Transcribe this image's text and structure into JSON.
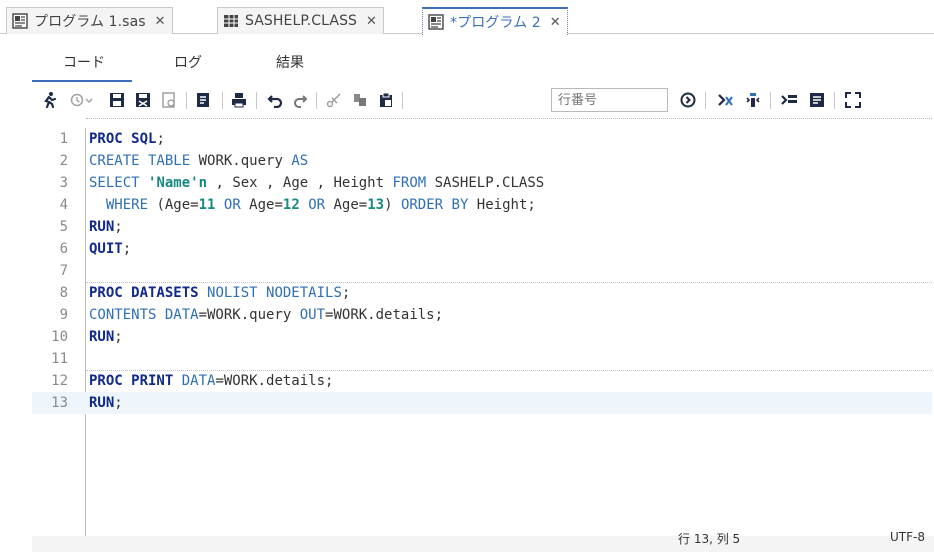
{
  "doc_tabs": [
    {
      "label": "プログラム 1.sas",
      "icon": "sas-program-icon",
      "active": false
    },
    {
      "label": "SASHELP.CLASS",
      "icon": "table-grid-icon",
      "active": false
    },
    {
      "label": "*プログラム 2",
      "icon": "sas-program-icon",
      "active": true
    }
  ],
  "sub_tabs": [
    {
      "label": "コード",
      "active": true
    },
    {
      "label": "ログ",
      "active": false
    },
    {
      "label": "結果",
      "active": false
    }
  ],
  "toolbar": {
    "buttons": [
      "run-icon",
      "history-icon",
      "save-icon",
      "save-as-icon",
      "save-as-template-icon",
      "open-program-icon",
      "print-icon",
      "undo-icon",
      "redo-icon",
      "cut-icon",
      "copy-icon",
      "paste-icon",
      "go-to-line-icon",
      "clear-icon",
      "format-code-icon",
      "add-snippet-icon",
      "editor-options-icon",
      "maximize-icon"
    ],
    "line_number_placeholder": "行番号"
  },
  "code": {
    "lines": [
      {
        "no": "1",
        "tokens": [
          [
            "kw-step",
            "PROC SQL"
          ],
          [
            "plain",
            ";"
          ]
        ]
      },
      {
        "no": "2",
        "tokens": [
          [
            "kw",
            "CREATE TABLE"
          ],
          [
            "plain",
            " WORK.query "
          ],
          [
            "kw",
            "AS"
          ]
        ]
      },
      {
        "no": "3",
        "tokens": [
          [
            "kw",
            "SELECT"
          ],
          [
            "plain",
            " "
          ],
          [
            "str",
            "'Name'n"
          ],
          [
            "plain",
            " , Sex , Age , Height "
          ],
          [
            "kw",
            "FROM"
          ],
          [
            "plain",
            " SASHELP.CLASS"
          ]
        ]
      },
      {
        "no": "4",
        "tokens": [
          [
            "plain",
            "  "
          ],
          [
            "kw",
            "WHERE"
          ],
          [
            "plain",
            " (Age="
          ],
          [
            "num",
            "11"
          ],
          [
            "plain",
            " "
          ],
          [
            "kw",
            "OR"
          ],
          [
            "plain",
            " Age="
          ],
          [
            "num",
            "12"
          ],
          [
            "plain",
            " "
          ],
          [
            "kw",
            "OR"
          ],
          [
            "plain",
            " Age="
          ],
          [
            "num",
            "13"
          ],
          [
            "plain",
            ") "
          ],
          [
            "kw",
            "ORDER BY"
          ],
          [
            "plain",
            " Height;"
          ]
        ]
      },
      {
        "no": "5",
        "tokens": [
          [
            "kw-step",
            "RUN"
          ],
          [
            "plain",
            ";"
          ]
        ]
      },
      {
        "no": "6",
        "tokens": [
          [
            "kw-step",
            "QUIT"
          ],
          [
            "plain",
            ";"
          ]
        ]
      },
      {
        "no": "7",
        "tokens": []
      },
      {
        "no": "8",
        "tokens": [
          [
            "kw-step",
            "PROC DATASETS"
          ],
          [
            "plain",
            " "
          ],
          [
            "kw",
            "NOLIST NODETAILS"
          ],
          [
            "plain",
            ";"
          ]
        ]
      },
      {
        "no": "9",
        "tokens": [
          [
            "kw",
            "CONTENTS DATA"
          ],
          [
            "plain",
            "=WORK.query "
          ],
          [
            "kw",
            "OUT"
          ],
          [
            "plain",
            "=WORK.details;"
          ]
        ]
      },
      {
        "no": "10",
        "tokens": [
          [
            "kw-step",
            "RUN"
          ],
          [
            "plain",
            ";"
          ]
        ]
      },
      {
        "no": "11",
        "tokens": []
      },
      {
        "no": "12",
        "tokens": [
          [
            "kw-step",
            "PROC PRINT"
          ],
          [
            "plain",
            " "
          ],
          [
            "kw",
            "DATA"
          ],
          [
            "plain",
            "=WORK.details;"
          ]
        ]
      },
      {
        "no": "13",
        "tokens": [
          [
            "kw-step",
            "RUN"
          ],
          [
            "plain",
            ";"
          ]
        ]
      }
    ],
    "current_line": 13
  },
  "status": {
    "position": "行 13, 列 5",
    "encoding": "UTF-8"
  },
  "colors": {
    "accent": "#3b6fb8",
    "step_keyword": "#102a8c",
    "keyword": "#2f6fb5",
    "literal": "#18897f",
    "current_line_bg": "#eef5fb"
  }
}
